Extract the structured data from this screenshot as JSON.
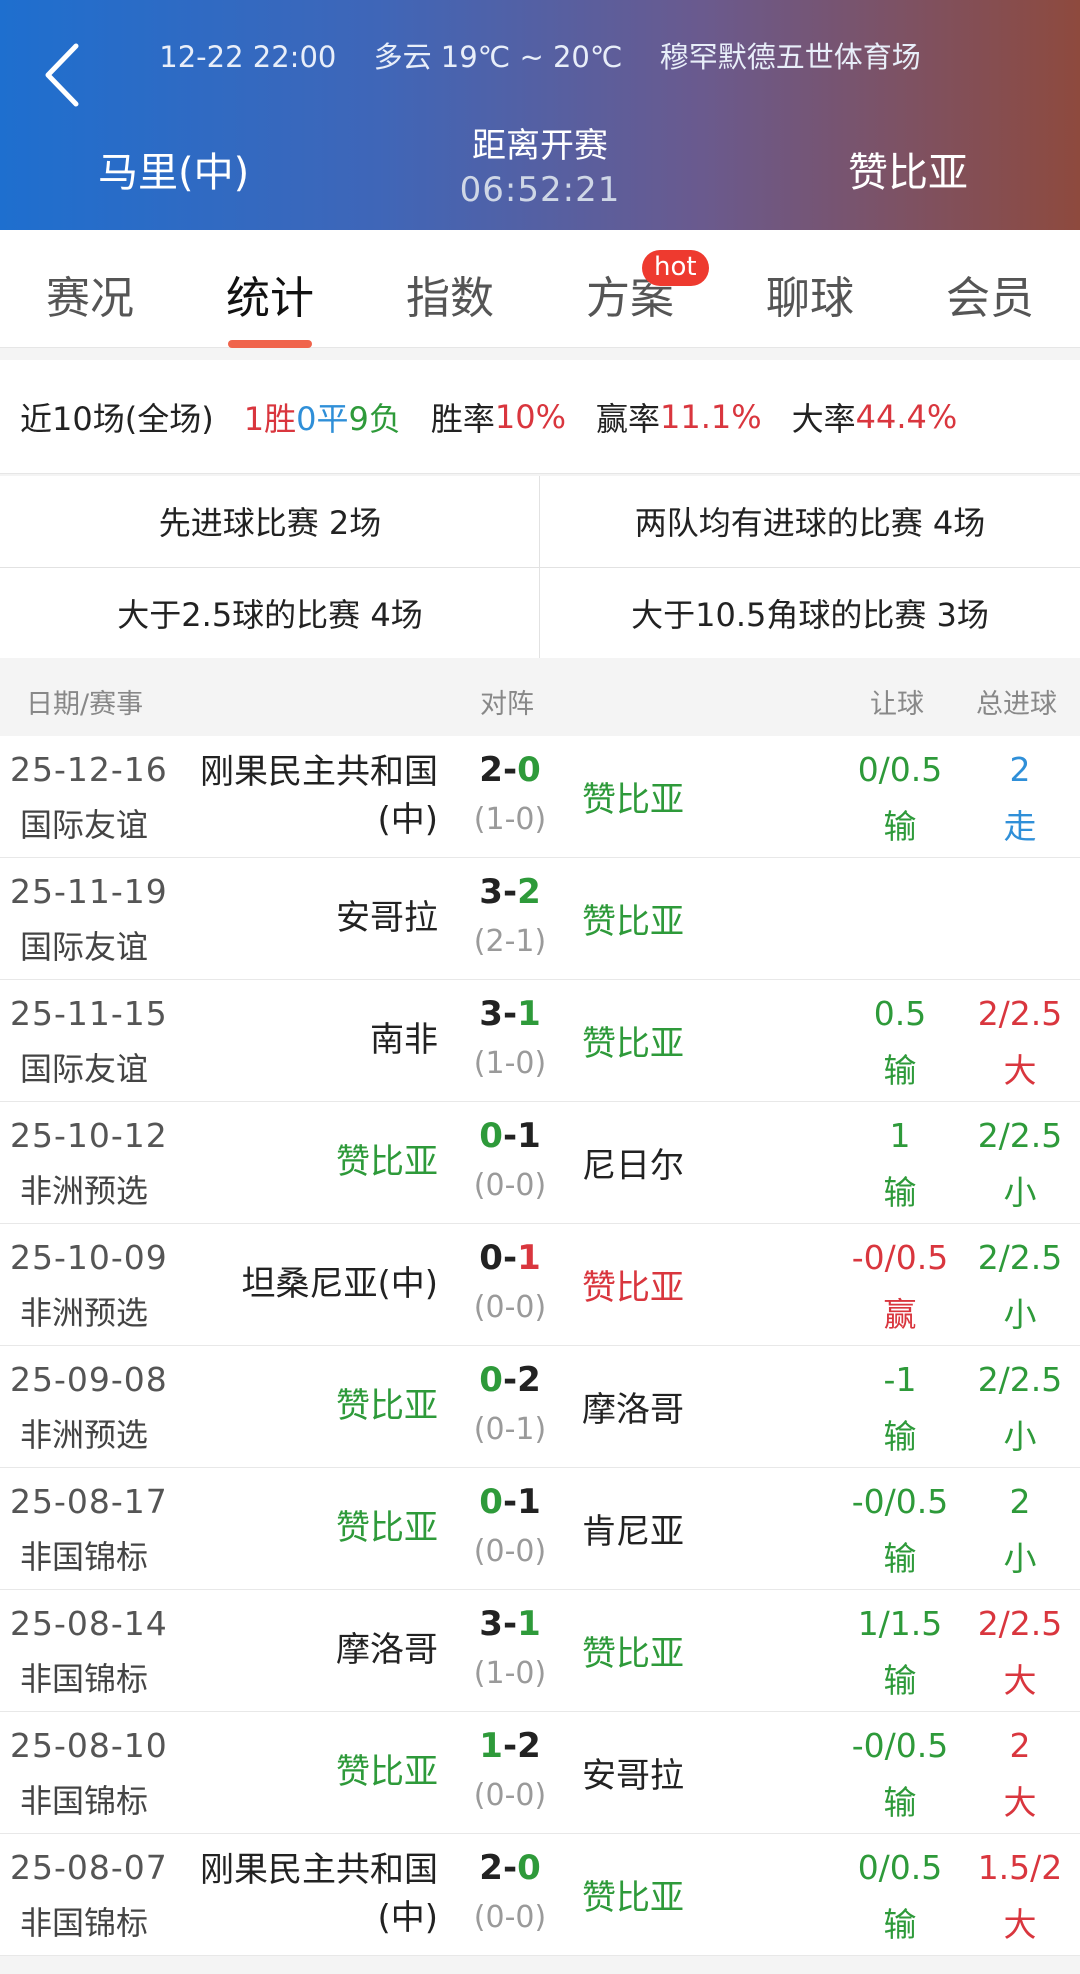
{
  "header": {
    "datetime": "12-22 22:00",
    "weather": "多云 19℃ ~ 20℃",
    "venue": "穆罕默德五世体育场",
    "home_team": "马里(中)",
    "away_team": "赞比亚",
    "countdown_label": "距离开赛",
    "countdown_time": "06:52:21",
    "colors": {
      "gradient_start": "#1e6fcf",
      "gradient_end": "#8e4a3e"
    }
  },
  "tabs": [
    {
      "label": "赛况",
      "active": false
    },
    {
      "label": "统计",
      "active": true
    },
    {
      "label": "指数",
      "active": false
    },
    {
      "label": "方案",
      "active": false
    },
    {
      "label": "聊球",
      "active": false
    },
    {
      "label": "会员",
      "active": false
    }
  ],
  "hot_badge": "hot",
  "summary": {
    "label": "近10场(全场)",
    "wins": "1胜",
    "draws": "0平",
    "losses": "9负",
    "win_rate_label": "胜率",
    "win_rate": "10%",
    "cover_rate_label": "赢率",
    "cover_rate": "11.1%",
    "over_rate_label": "大率",
    "over_rate": "44.4%"
  },
  "stats": [
    "先进球比赛 2场",
    "两队均有进球的比赛 4场",
    "大于2.5球的比赛 4场",
    "大于10.5角球的比赛 3场"
  ],
  "table_header": {
    "date": "日期/赛事",
    "match": "对阵",
    "handicap": "让球",
    "total": "总进球"
  },
  "rows": [
    {
      "date": "25-12-16",
      "league": "国际友谊",
      "home": [
        "刚果民主共和国",
        "(中)"
      ],
      "home_color": "dark",
      "score_home": "2",
      "score_away": "0",
      "sh_color": "dark",
      "sa_color": "green",
      "half": "(1-0)",
      "away": "赞比亚",
      "away_color": "green",
      "hc": "0/0.5",
      "hc_res": "输",
      "hc_color": "green",
      "tg": "2",
      "tg_res": "走",
      "tg_color": "blue"
    },
    {
      "date": "25-11-19",
      "league": "国际友谊",
      "home": [
        "安哥拉"
      ],
      "home_color": "dark",
      "score_home": "3",
      "score_away": "2",
      "sh_color": "dark",
      "sa_color": "green",
      "half": "(2-1)",
      "away": "赞比亚",
      "away_color": "green",
      "hc": "",
      "hc_res": "",
      "hc_color": "green",
      "tg": "",
      "tg_res": "",
      "tg_color": "green"
    },
    {
      "date": "25-11-15",
      "league": "国际友谊",
      "home": [
        "南非"
      ],
      "home_color": "dark",
      "score_home": "3",
      "score_away": "1",
      "sh_color": "dark",
      "sa_color": "green",
      "half": "(1-0)",
      "away": "赞比亚",
      "away_color": "green",
      "hc": "0.5",
      "hc_res": "输",
      "hc_color": "green",
      "tg": "2/2.5",
      "tg_res": "大",
      "tg_color": "red"
    },
    {
      "date": "25-10-12",
      "league": "非洲预选",
      "home": [
        "赞比亚"
      ],
      "home_color": "green",
      "score_home": "0",
      "score_away": "1",
      "sh_color": "green",
      "sa_color": "dark",
      "half": "(0-0)",
      "away": "尼日尔",
      "away_color": "dark",
      "hc": "1",
      "hc_res": "输",
      "hc_color": "green",
      "tg": "2/2.5",
      "tg_res": "小",
      "tg_color": "green"
    },
    {
      "date": "25-10-09",
      "league": "非洲预选",
      "home": [
        "坦桑尼亚(中)"
      ],
      "home_color": "dark",
      "score_home": "0",
      "score_away": "1",
      "sh_color": "dark",
      "sa_color": "red",
      "half": "(0-0)",
      "away": "赞比亚",
      "away_color": "red",
      "hc": "-0/0.5",
      "hc_res": "赢",
      "hc_color": "red",
      "tg": "2/2.5",
      "tg_res": "小",
      "tg_color": "green"
    },
    {
      "date": "25-09-08",
      "league": "非洲预选",
      "home": [
        "赞比亚"
      ],
      "home_color": "green",
      "score_home": "0",
      "score_away": "2",
      "sh_color": "green",
      "sa_color": "dark",
      "half": "(0-1)",
      "away": "摩洛哥",
      "away_color": "dark",
      "hc": "-1",
      "hc_res": "输",
      "hc_color": "green",
      "tg": "2/2.5",
      "tg_res": "小",
      "tg_color": "green"
    },
    {
      "date": "25-08-17",
      "league": "非国锦标",
      "home": [
        "赞比亚"
      ],
      "home_color": "green",
      "score_home": "0",
      "score_away": "1",
      "sh_color": "green",
      "sa_color": "dark",
      "half": "(0-0)",
      "away": "肯尼亚",
      "away_color": "dark",
      "hc": "-0/0.5",
      "hc_res": "输",
      "hc_color": "green",
      "tg": "2",
      "tg_res": "小",
      "tg_color": "green"
    },
    {
      "date": "25-08-14",
      "league": "非国锦标",
      "home": [
        "摩洛哥"
      ],
      "home_color": "dark",
      "score_home": "3",
      "score_away": "1",
      "sh_color": "dark",
      "sa_color": "green",
      "half": "(1-0)",
      "away": "赞比亚",
      "away_color": "green",
      "hc": "1/1.5",
      "hc_res": "输",
      "hc_color": "green",
      "tg": "2/2.5",
      "tg_res": "大",
      "tg_color": "red"
    },
    {
      "date": "25-08-10",
      "league": "非国锦标",
      "home": [
        "赞比亚"
      ],
      "home_color": "green",
      "score_home": "1",
      "score_away": "2",
      "sh_color": "green",
      "sa_color": "dark",
      "half": "(0-0)",
      "away": "安哥拉",
      "away_color": "dark",
      "hc": "-0/0.5",
      "hc_res": "输",
      "hc_color": "green",
      "tg": "2",
      "tg_res": "大",
      "tg_color": "red"
    },
    {
      "date": "25-08-07",
      "league": "非国锦标",
      "home": [
        "刚果民主共和国",
        "(中)"
      ],
      "home_color": "dark",
      "score_home": "2",
      "score_away": "0",
      "sh_color": "dark",
      "sa_color": "green",
      "half": "(0-0)",
      "away": "赞比亚",
      "away_color": "green",
      "hc": "0/0.5",
      "hc_res": "输",
      "hc_color": "green",
      "tg": "1.5/2",
      "tg_res": "大",
      "tg_color": "red"
    }
  ]
}
